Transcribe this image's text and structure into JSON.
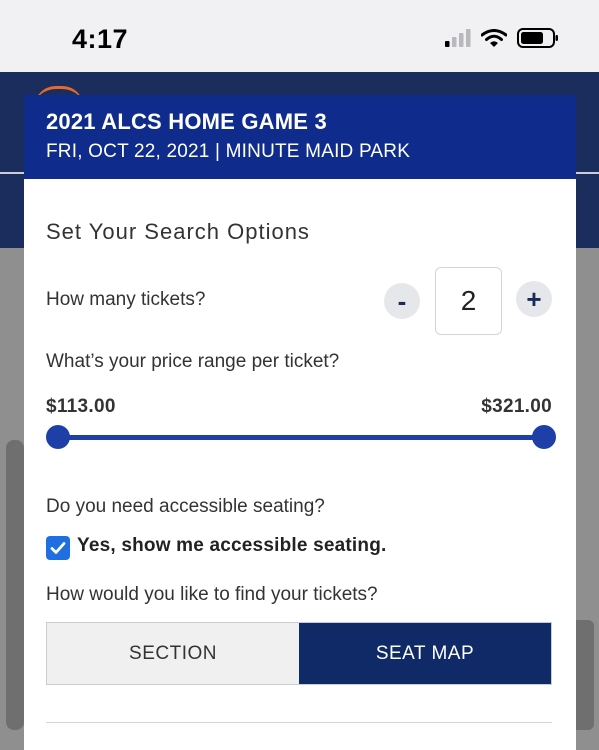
{
  "status_bar": {
    "time": "4:17"
  },
  "game": {
    "title": "2021 ALCS HOME GAME 3",
    "subtitle": "FRI, OCT 22, 2021 | MINUTE MAID PARK"
  },
  "search_options": {
    "title": "Set Your Search Options",
    "tickets": {
      "label": "How many tickets?",
      "quantity": "2",
      "minus_label": "-",
      "plus_label": "+"
    },
    "price": {
      "label": "What’s your price range per ticket?",
      "min": "$113.00",
      "max": "$321.00"
    },
    "accessible": {
      "label": "Do you need accessible seating?",
      "option_label": "Yes, show me accessible seating.",
      "checked": true
    },
    "find": {
      "label": "How would you like to find your tickets?",
      "options": [
        "SECTION",
        "SEAT MAP"
      ],
      "selected": "SEAT MAP"
    }
  },
  "colors": {
    "header": "#0f2c8c",
    "accent": "#1f3fa8",
    "selected_option": "#0f2a66"
  },
  "icons": [
    "signal-icon",
    "wifi-icon",
    "battery-icon",
    "checkmark-icon"
  ]
}
